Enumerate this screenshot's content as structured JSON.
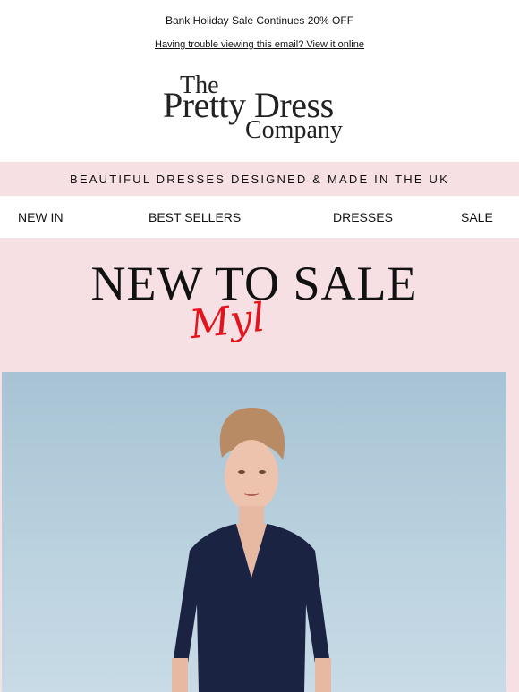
{
  "header": {
    "promo": "Bank Holiday Sale Continues 20% OFF",
    "view_online": "Having trouble viewing this email? View it online"
  },
  "logo": {
    "line1": "The",
    "line2": "Pretty Dress",
    "line3": "Company"
  },
  "tagline": "BEAUTIFUL DRESSES DESIGNED & MADE IN THE UK",
  "nav": {
    "items": [
      {
        "label": "NEW IN"
      },
      {
        "label": "BEST SELLERS"
      },
      {
        "label": "DRESSES"
      },
      {
        "label": "SALE"
      }
    ]
  },
  "hero": {
    "title": "NEW TO SALE",
    "subtitle": "Myl"
  }
}
